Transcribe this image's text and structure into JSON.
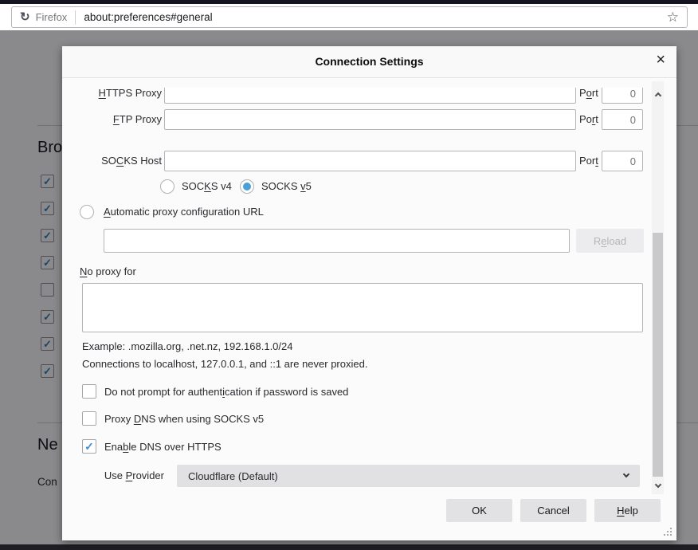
{
  "browser": {
    "name_label": "Firefox",
    "url": "about:preferences#general"
  },
  "background_page": {
    "browsing_heading": "Bro",
    "checkbox_states": [
      true,
      true,
      true,
      true,
      false,
      true,
      true,
      true
    ],
    "network_heading": "Ne",
    "configure_text": "Con"
  },
  "dialog": {
    "title": "Connection Settings",
    "proxy_rows": [
      {
        "label": [
          "",
          "H",
          "TTPS Proxy"
        ],
        "value": "",
        "port_label": [
          "P",
          "o",
          "rt"
        ],
        "port_value": "0"
      },
      {
        "label": [
          "",
          "F",
          "TP Proxy"
        ],
        "value": "",
        "port_label": [
          "Po",
          "r",
          "t"
        ],
        "port_value": "0"
      },
      {
        "label": [
          "SO",
          "C",
          "KS Host"
        ],
        "value": "",
        "port_label": [
          "Por",
          "t",
          ""
        ],
        "port_value": "0"
      }
    ],
    "socks_v4": {
      "label": [
        "SOC",
        "K",
        "S v4"
      ],
      "selected": false
    },
    "socks_v5": {
      "label": [
        "SOCKS ",
        "v",
        "5"
      ],
      "selected": true
    },
    "auto_proxy": {
      "label": [
        "",
        "A",
        "utomatic proxy configuration URL"
      ],
      "selected": false,
      "url_value": "",
      "reload_label": [
        "R",
        "e",
        "load"
      ],
      "reload_enabled": false
    },
    "no_proxy": {
      "label": [
        "",
        "N",
        "o proxy for"
      ],
      "value": "",
      "example": "Example: .mozilla.org, .net.nz, 192.168.1.0/24",
      "note": "Connections to localhost, 127.0.0.1, and ::1 are never proxied."
    },
    "checkboxes": [
      {
        "label": [
          "Do not prompt for authent",
          "i",
          "cation if password is saved"
        ],
        "checked": false
      },
      {
        "label": [
          "Proxy ",
          "D",
          "NS when using SOCKS v5"
        ],
        "checked": false
      },
      {
        "label": [
          "Ena",
          "b",
          "le DNS over HTTPS"
        ],
        "checked": true
      }
    ],
    "provider": {
      "label": [
        "Use ",
        "P",
        "rovider"
      ],
      "value": "Cloudflare (Default)"
    },
    "buttons": {
      "ok": "OK",
      "cancel": "Cancel",
      "help": [
        "",
        "H",
        "elp"
      ]
    }
  },
  "colors": {
    "accent_blue": "#4a9fd8",
    "check_blue": "#3d8fd1"
  }
}
